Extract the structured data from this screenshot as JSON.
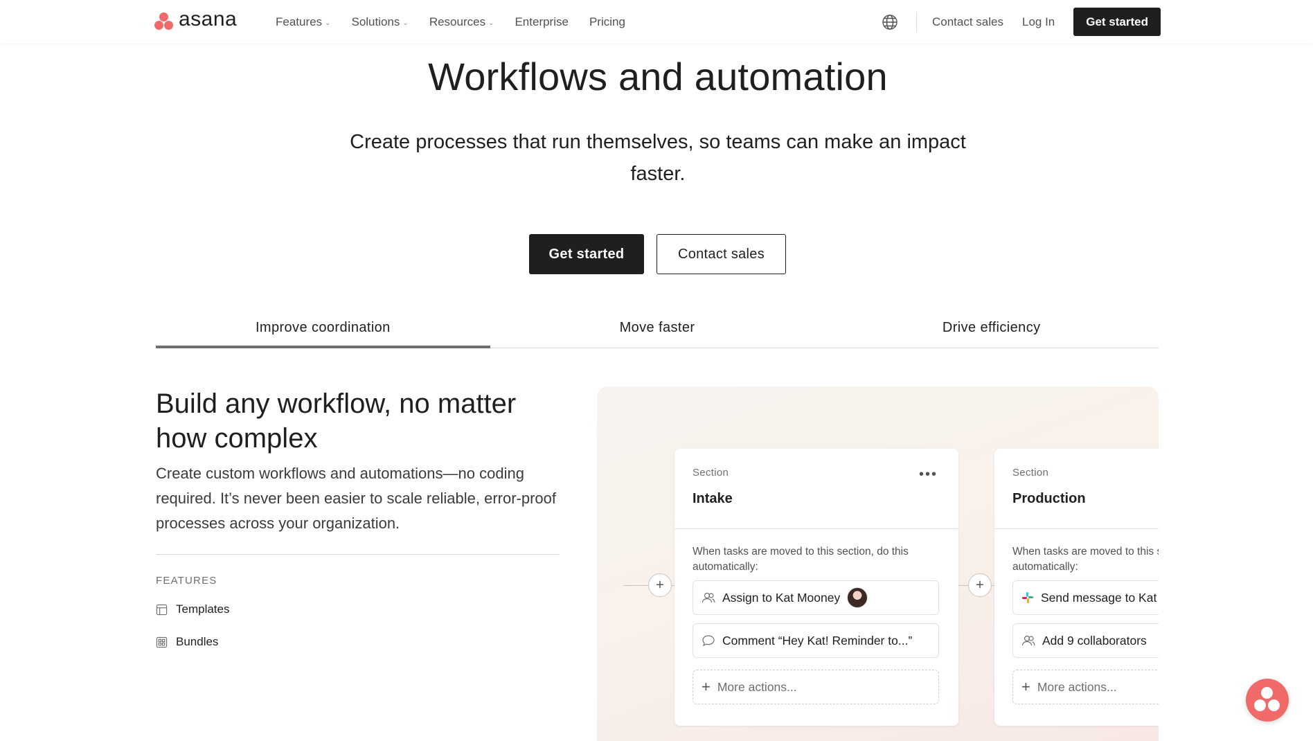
{
  "nav": {
    "logo_text": "asana",
    "links": [
      {
        "label": "Features",
        "has_menu": true
      },
      {
        "label": "Solutions",
        "has_menu": true
      },
      {
        "label": "Resources",
        "has_menu": true
      },
      {
        "label": "Enterprise",
        "has_menu": false
      },
      {
        "label": "Pricing",
        "has_menu": false
      }
    ],
    "contact_sales": "Contact sales",
    "login": "Log In",
    "cta": "Get started",
    "globe_icon": "globe-icon"
  },
  "hero": {
    "title": "Workflows and automation",
    "subtitle": "Create processes that run themselves, so teams can make an impact faster.",
    "primary_button": "Get started",
    "secondary_button": "Contact sales"
  },
  "tabs": [
    {
      "label": "Improve coordination",
      "active": true
    },
    {
      "label": "Move faster",
      "active": false
    },
    {
      "label": "Drive efficiency",
      "active": false
    }
  ],
  "feature": {
    "title": "Build any workflow, no matter how complex",
    "description": "Create custom workflows and automations—no coding required. It’s never been easier to scale reliable, error-proof processes across your organization.",
    "features_label": "FEATURES",
    "items": [
      {
        "label": "Templates",
        "icon": "template-icon"
      },
      {
        "label": "Bundles",
        "icon": "bundle-icon"
      }
    ]
  },
  "illustration": {
    "cards": [
      {
        "section_label": "Section",
        "name": "Intake",
        "rule_text": "When tasks are moved to this section, do this automatically:",
        "actions": [
          {
            "label": "Assign to Kat Mooney",
            "icon": "assignee-icon",
            "avatar": true
          },
          {
            "label": "Comment “Hey Kat! Reminder to...”",
            "icon": "comment-icon"
          }
        ],
        "more_actions": "More actions..."
      },
      {
        "section_label": "Section",
        "name": "Production",
        "rule_text": "When tasks are moved to this section, do this automatically:",
        "actions": [
          {
            "label": "Send message to Kat",
            "icon": "slack-icon"
          },
          {
            "label": "Add 9 collaborators",
            "icon": "collaborators-icon"
          }
        ],
        "more_actions": "More actions..."
      }
    ]
  },
  "colors": {
    "brand_coral": "#f06a6a",
    "text_dark": "#1e1f21",
    "button_dark": "#1e1f21"
  }
}
